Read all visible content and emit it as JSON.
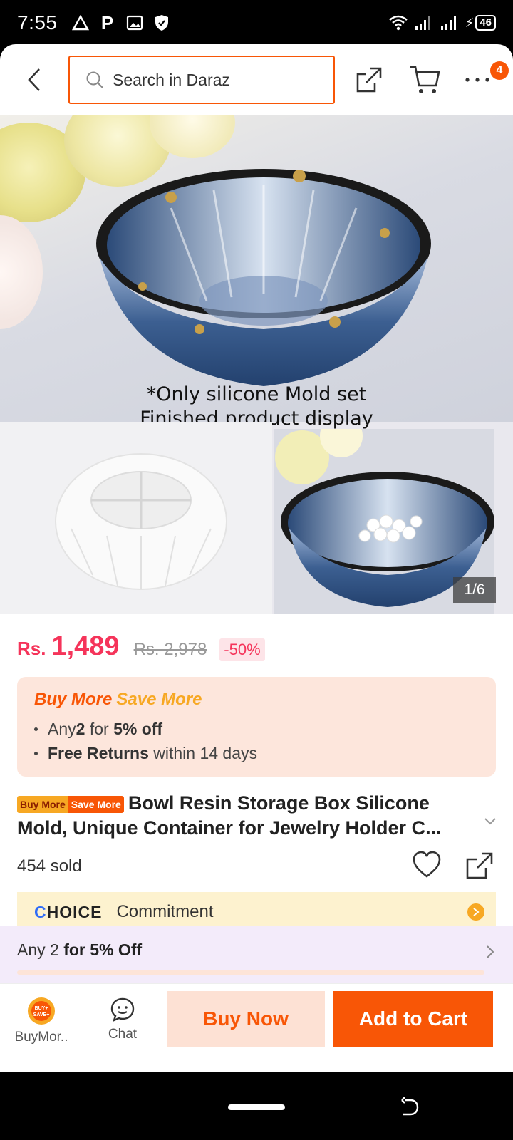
{
  "status_bar": {
    "time": "7:55",
    "battery": "46",
    "icons": [
      "drive-icon",
      "parking-icon",
      "gallery-icon",
      "shield-icon",
      "wifi-icon",
      "signal-icon",
      "signal-icon-2",
      "charging-icon"
    ]
  },
  "header": {
    "search_placeholder": "Search in Daraz",
    "cart_badge": "4"
  },
  "gallery": {
    "caption_line1": "*Only silicone Mold set",
    "caption_line2": "Finished product display",
    "counter": "1/6"
  },
  "price": {
    "currency": "Rs.",
    "current": "1,489",
    "original": "Rs. 2,978",
    "discount": "-50%"
  },
  "promo": {
    "title_part1": "Buy More",
    "title_part2": "Save More",
    "line1": {
      "a": "Any ",
      "b": "2",
      "c": " for ",
      "d": "5% off"
    },
    "line2": {
      "a": "Free Returns",
      "b": " within 14 days"
    }
  },
  "product": {
    "tag_part1": "Buy More",
    "tag_part2": "Save More",
    "title": "Bowl Resin Storage Box Silicone Mold, Unique Container for Jewelry Holder C...",
    "sold": "454 sold"
  },
  "choice": {
    "logo_c": "C",
    "logo_rest": "HOICE",
    "text": "Commitment"
  },
  "offer": {
    "text_a": "Any 2 ",
    "text_b": "for 5% Off"
  },
  "action_bar": {
    "buymore_label": "BuyMor..",
    "buymore_icon_text": "BUY+\nSAVE+",
    "chat_label": "Chat",
    "buy_now": "Buy Now",
    "add_to_cart": "Add to Cart"
  },
  "colors": {
    "brand": "#f85606",
    "price": "#f5345a",
    "promo_bg": "#fde6dc",
    "choice_bg": "#fdf2cf"
  }
}
